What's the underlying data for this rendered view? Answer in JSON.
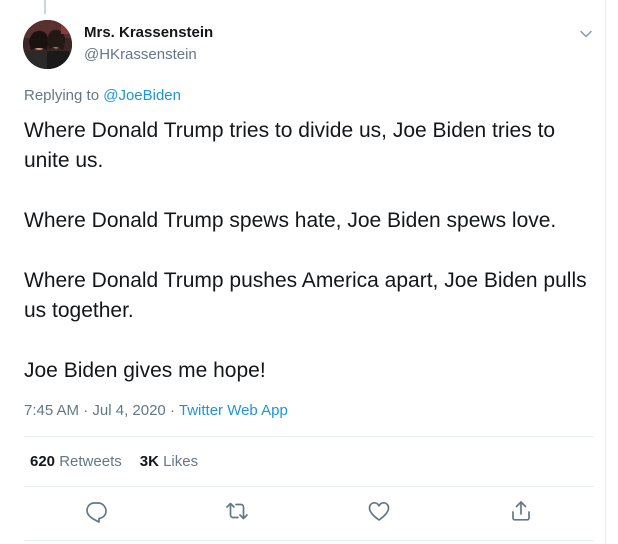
{
  "tweet": {
    "author_name": "Mrs. Krassenstein",
    "author_handle": "@HKrassenstein",
    "replying_prefix": "Replying to ",
    "replying_to": "@JoeBiden",
    "paragraphs": [
      "Where Donald Trump tries to divide us, Joe Biden tries to unite us.",
      "Where Donald Trump spews hate, Joe Biden spews love.",
      "Where Donald Trump pushes America apart, Joe Biden pulls us together.",
      "Joe Biden gives me hope!"
    ],
    "time": "7:45 AM",
    "separator": "·",
    "date": "Jul 4, 2020",
    "source_app": "Twitter Web App"
  },
  "stats": {
    "retweets_count": "620",
    "retweets_label": "Retweets",
    "likes_count": "3K",
    "likes_label": "Likes"
  },
  "icons": {
    "menu": "chevron-down-icon",
    "reply": "reply-icon",
    "retweet": "retweet-icon",
    "like": "heart-icon",
    "share": "share-icon"
  },
  "colors": {
    "link": "#1b95e0",
    "secondary_text": "#657786",
    "primary_text": "#14171a",
    "divider": "#e6ecf0"
  }
}
